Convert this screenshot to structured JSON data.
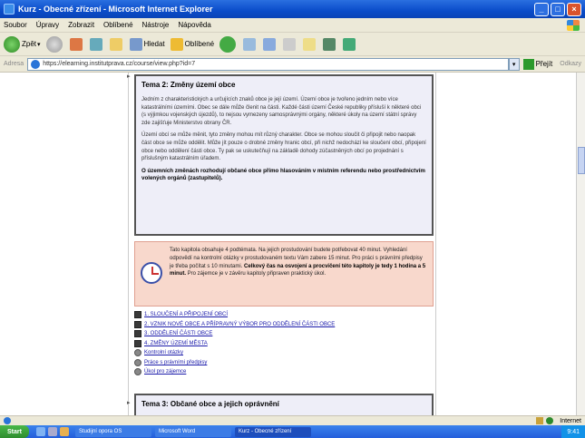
{
  "window": {
    "title": "Kurz - Obecné zřízení - Microsoft Internet Explorer"
  },
  "menu": [
    "Soubor",
    "Úpravy",
    "Zobrazit",
    "Oblíbené",
    "Nástroje",
    "Nápověda"
  ],
  "toolbar": {
    "back": "Zpět",
    "search": "Hledat",
    "favorites": "Oblíbené"
  },
  "address": {
    "label": "Adresa",
    "url": "https://elearning.institutprava.cz/course/view.php?id=7",
    "go": "Přejít",
    "links": "Odkazy"
  },
  "topic2": {
    "heading": "Tema 2: Změny území obce",
    "p1": "Jedním z charakteristických a určujících znaků obce je její území. Území obce je tvořeno jedním nebo více katastrálními územími. Obec se dále může členit na části. Každé části území České republiky přísluší k některé obci (s výjimkou vojenských újezdů), to nejsou vymezeny samosprávnými orgány, některé úkoly na území státní správy zde zajišťuje Ministerstvo obrany ČR.",
    "p2": "Území obcí se může měnit, tyto změny mohou mít různý charakter. Obce se mohou sloučit či připojit nebo naopak část obce se může oddělit. Může jít pouze o drobné změny hranic obcí, při nichž nedochází ke sloučení obcí, připojení obce nebo oddělení části obce. Ty pak se uskutečňují na základě dohody zúčastněných obcí po projednání s příslušným katastrálním úřadem.",
    "p3": "O územních změnách rozhodují občané obce přímo hlasováním v místním referendu nebo prostřednictvím volených orgánů (zastupitelů)."
  },
  "time_box": {
    "text": "Tato kapitola obsahuje 4 podtémata. Na jejich prostudování budete potřebovat 40 minut. Vyhledání odpovědí na kontrolní otázky v prostudovaném textu Vám zabere 15 minut. Pro práci s právními předpisy je třeba počítat s 10 minutami.",
    "bold": "Celkový čas na osvojení a procvičení této kapitoly je tedy 1 hodina a 5 minut.",
    "tail": "Pro zájemce je v závěru kapitoly připraven praktický úkol."
  },
  "links": [
    {
      "label": "1. SLOUČENÍ A PŘIPOJENÍ OBCÍ",
      "icon": "document-icon"
    },
    {
      "label": "2. VZNIK NOVÉ OBCE A PŘÍPRAVNÝ VÝBOR PRO ODDĚLENÍ ČÁSTI OBCE",
      "icon": "document-icon"
    },
    {
      "label": "3. ODDĚLENÍ ČÁSTI OBCE",
      "icon": "document-icon"
    },
    {
      "label": "4. ZMĚNY ÚZEMÍ MĚSTA",
      "icon": "document-icon"
    },
    {
      "label": "Kontrolní otázky",
      "icon": "quiz-icon"
    },
    {
      "label": "Práce s právními předpisy",
      "icon": "quiz-icon"
    },
    {
      "label": "Úkol pro zájemce",
      "icon": "quiz-icon"
    }
  ],
  "topic3": {
    "heading": "Tema 3: Občané obce a jejich oprávnění"
  },
  "status": {
    "zone": "Internet"
  },
  "taskbar": {
    "start": "Start",
    "tasks": [
      "Studijní opora OS",
      "Microsoft Word",
      "Kurz - Obecné zřízení"
    ],
    "clock": "9:41"
  }
}
